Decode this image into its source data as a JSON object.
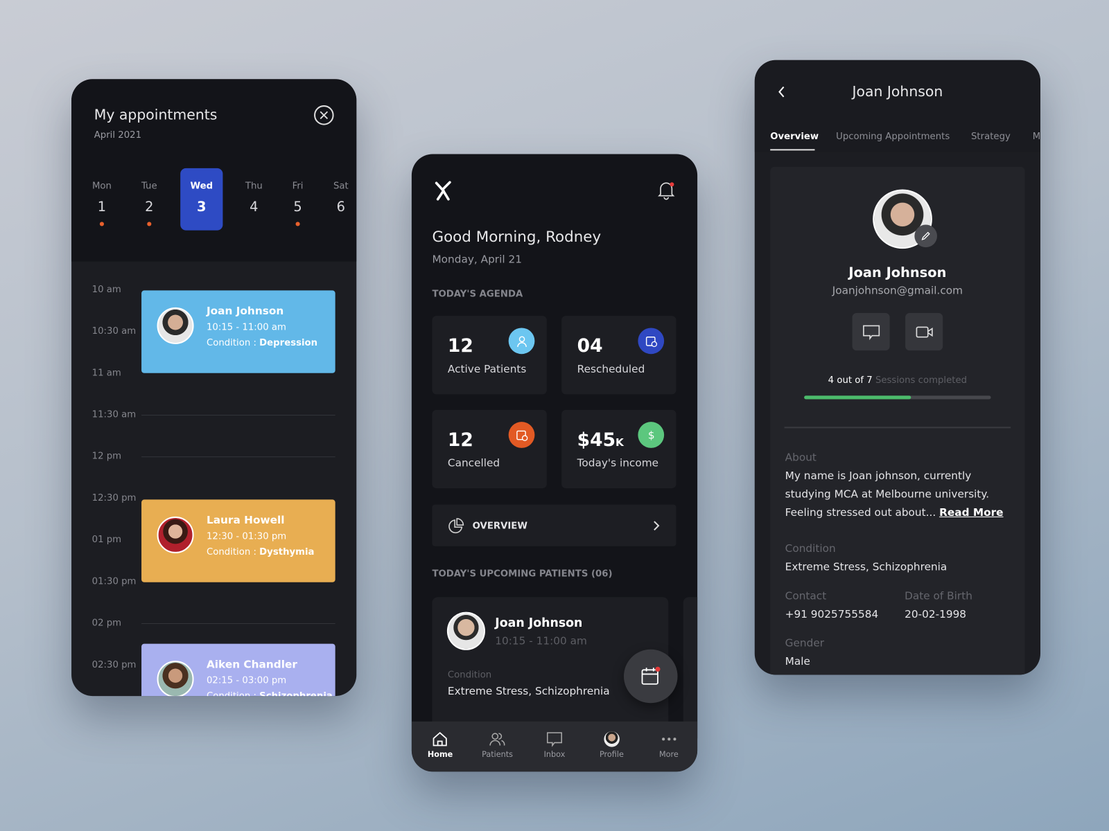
{
  "appointments": {
    "title": "My appointments",
    "month": "April 2021",
    "days": [
      {
        "label": "Mon",
        "num": "1",
        "has_event": true
      },
      {
        "label": "Tue",
        "num": "2",
        "has_event": true
      },
      {
        "label": "Wed",
        "num": "3",
        "has_event": false,
        "selected": true
      },
      {
        "label": "Thu",
        "num": "4",
        "has_event": false
      },
      {
        "label": "Fri",
        "num": "5",
        "has_event": true
      },
      {
        "label": "Sat",
        "num": "6",
        "has_event": false
      }
    ],
    "times": [
      "10 am",
      "10:30 am",
      "11 am",
      "11:30 am",
      "12 pm",
      "12:30 pm",
      "01 pm",
      "01:30 pm",
      "02 pm",
      "02:30 pm"
    ],
    "items": [
      {
        "name": "Joan Johnson",
        "time": "10:15 - 11:00 am",
        "condition_label": "Condition : ",
        "condition": "Depression",
        "color": "#62b8e8"
      },
      {
        "name": "Laura Howell",
        "time": "12:30 - 01:30 pm",
        "condition_label": "Condition : ",
        "condition": "Dysthymia",
        "color": "#e8ae52"
      },
      {
        "name": "Aiken Chandler",
        "time": "02:15 - 03:00 pm",
        "condition_label": "Condition : ",
        "condition": "Schizophrenia",
        "color": "#a9b0ef"
      }
    ]
  },
  "home": {
    "greeting": "Good Morning, Rodney",
    "date": "Monday, April 21",
    "agenda_title": "TODAY'S AGENDA",
    "stats": [
      {
        "value": "12",
        "label": "Active Patients",
        "icon": "user-icon",
        "color": "#6cc6f0"
      },
      {
        "value": "04",
        "label": "Rescheduled",
        "icon": "calendar-clock-icon",
        "color": "#2f48c2"
      },
      {
        "value": "12",
        "label": "Cancelled",
        "icon": "calendar-cancel-icon",
        "color": "#e25a24"
      },
      {
        "value": "$45",
        "unit": "K",
        "label": "Today's income",
        "icon": "dollar-icon",
        "color": "#5cc77e"
      }
    ],
    "overview_label": "OVERVIEW",
    "upcoming_title": "TODAY'S UPCOMING PATIENTS (06)",
    "patient": {
      "name": "Joan Johnson",
      "time": "10:15 - 11:00 am",
      "condition_label": "Condition",
      "condition": "Extreme Stress, Schizophrenia"
    },
    "nav": [
      "Home",
      "Patients",
      "Inbox",
      "Profile",
      "More"
    ]
  },
  "profile": {
    "title": "Joan Johnson",
    "tabs": [
      "Overview",
      "Upcoming Appointments",
      "Strategy",
      "M"
    ],
    "name": "Joan Johnson",
    "email": "Joanjohnson@gmail.com",
    "sessions_done": "4 out of 7",
    "sessions_suffix": " Sessions completed",
    "sessions_progress": 0.571,
    "about_label": "About",
    "about": "My name is Joan johnson, currently studying MCA at Melbourne university. Feeling stressed out about... ",
    "about_l1": "My name is Joan johnson, currently",
    "about_l2": "studying MCA at Melbourne university.",
    "about_l3": "Feeling stressed out about... ",
    "read_more": "Read More",
    "condition_label": "Condition",
    "condition": "Extreme Stress, Schizophrenia",
    "contact_label": "Contact",
    "contact": "+91 9025755584",
    "dob_label": "Date of Birth",
    "dob": "20-02-1998",
    "gender_label": "Gender",
    "gender": "Male",
    "accent": "#4cbc6c"
  }
}
